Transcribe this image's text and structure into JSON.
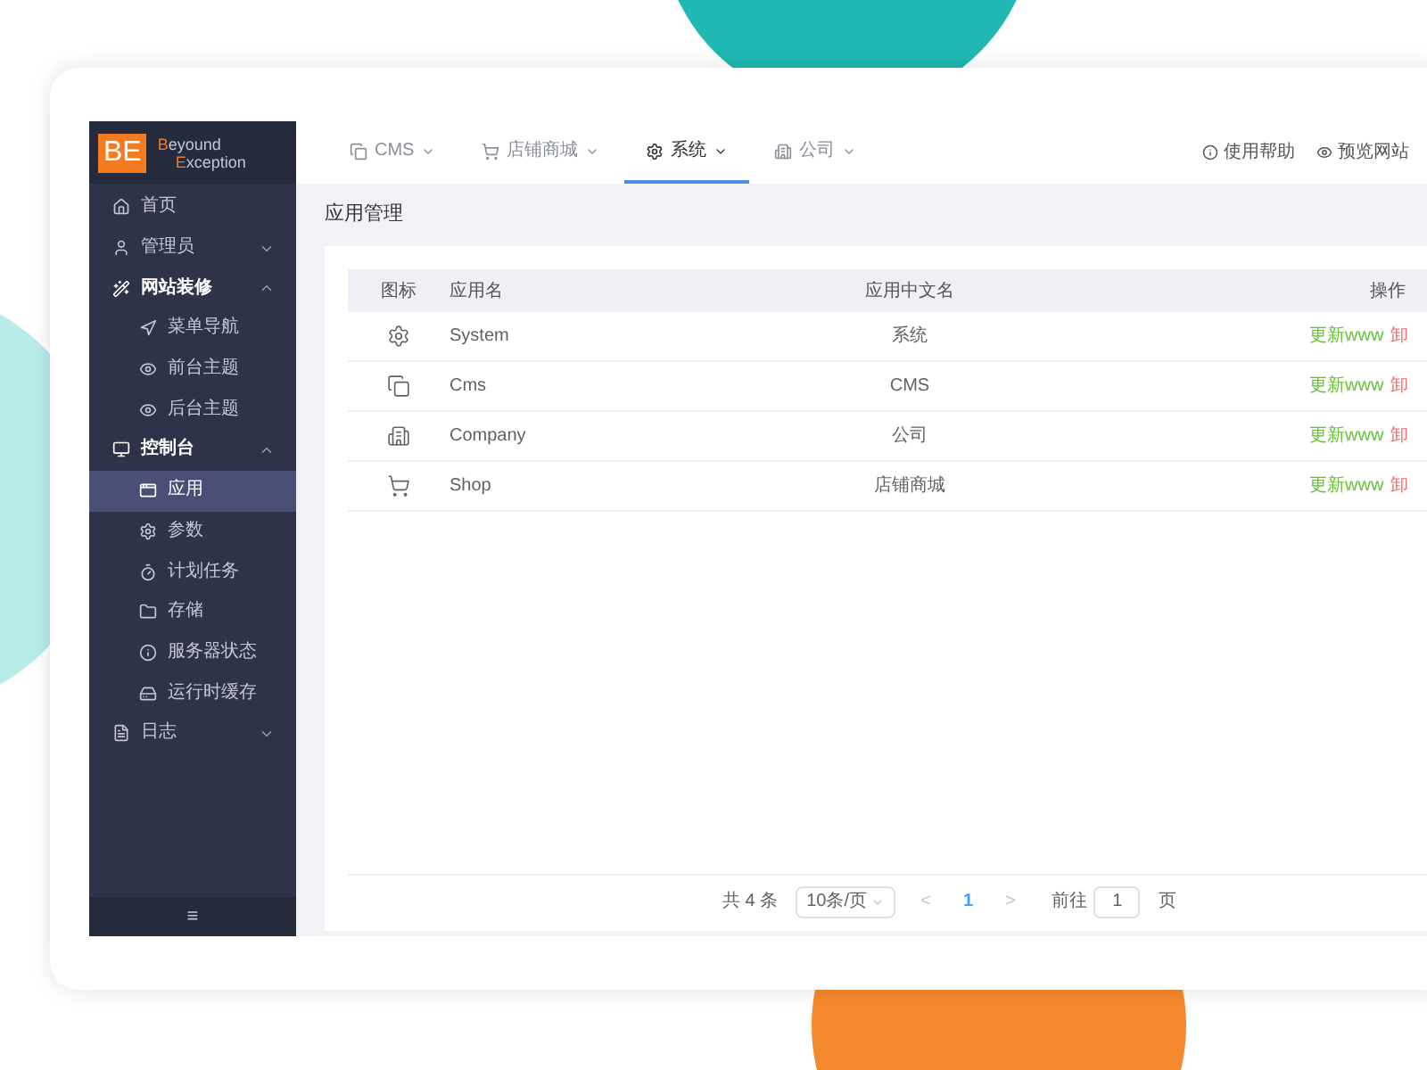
{
  "logo": {
    "mark": "BE",
    "line_1": "Beyound",
    "line_2": "Exception"
  },
  "sidebar": {
    "items": [
      {
        "label": "首页",
        "selected": false
      },
      {
        "label": "管理员",
        "expanded": false,
        "selected": false
      },
      {
        "label": "网站装修",
        "expanded": true,
        "selected": false,
        "children": [
          {
            "label": "菜单导航",
            "selected": false
          },
          {
            "label": "前台主题",
            "selected": false
          },
          {
            "label": "后台主题",
            "selected": false
          }
        ]
      },
      {
        "label": "控制台",
        "expanded": true,
        "selected": false,
        "children": [
          {
            "label": "应用",
            "selected": true
          },
          {
            "label": "参数",
            "selected": false
          },
          {
            "label": "计划任务",
            "selected": false
          },
          {
            "label": "存储",
            "selected": false
          },
          {
            "label": "服务器状态",
            "selected": false
          },
          {
            "label": "运行时缓存",
            "selected": false
          }
        ]
      },
      {
        "label": "日志",
        "expanded": false,
        "selected": false
      }
    ],
    "collapse_button": "≡"
  },
  "tabs": [
    {
      "label": "CMS",
      "selected": false
    },
    {
      "label": "店铺商城",
      "selected": false
    },
    {
      "label": "系统",
      "selected": true
    },
    {
      "label": "公司",
      "selected": false
    }
  ],
  "header_links": [
    "使用帮助",
    "预览网站"
  ],
  "page_title": "应用管理",
  "table": {
    "columns": [
      "图标",
      "应用名",
      "应用中文名",
      "操作"
    ],
    "rows": [
      {
        "name": "System",
        "name_zh": "系统",
        "actions": [
          "更新www",
          "卸"
        ]
      },
      {
        "name": "Cms",
        "name_zh": "CMS",
        "actions": [
          "更新www",
          "卸"
        ]
      },
      {
        "name": "Company",
        "name_zh": "公司",
        "actions": [
          "更新www",
          "卸"
        ]
      },
      {
        "name": "Shop",
        "name_zh": "店铺商城",
        "actions": [
          "更新www",
          "卸"
        ]
      }
    ]
  },
  "pagination": {
    "total": "共 4 条",
    "page_size": "10条/页",
    "prev": "<",
    "pages": [
      {
        "label": "1",
        "selected": true
      }
    ],
    "next": ">",
    "goto_label": "前往",
    "goto_value": "1",
    "goto_suffix": "页"
  }
}
